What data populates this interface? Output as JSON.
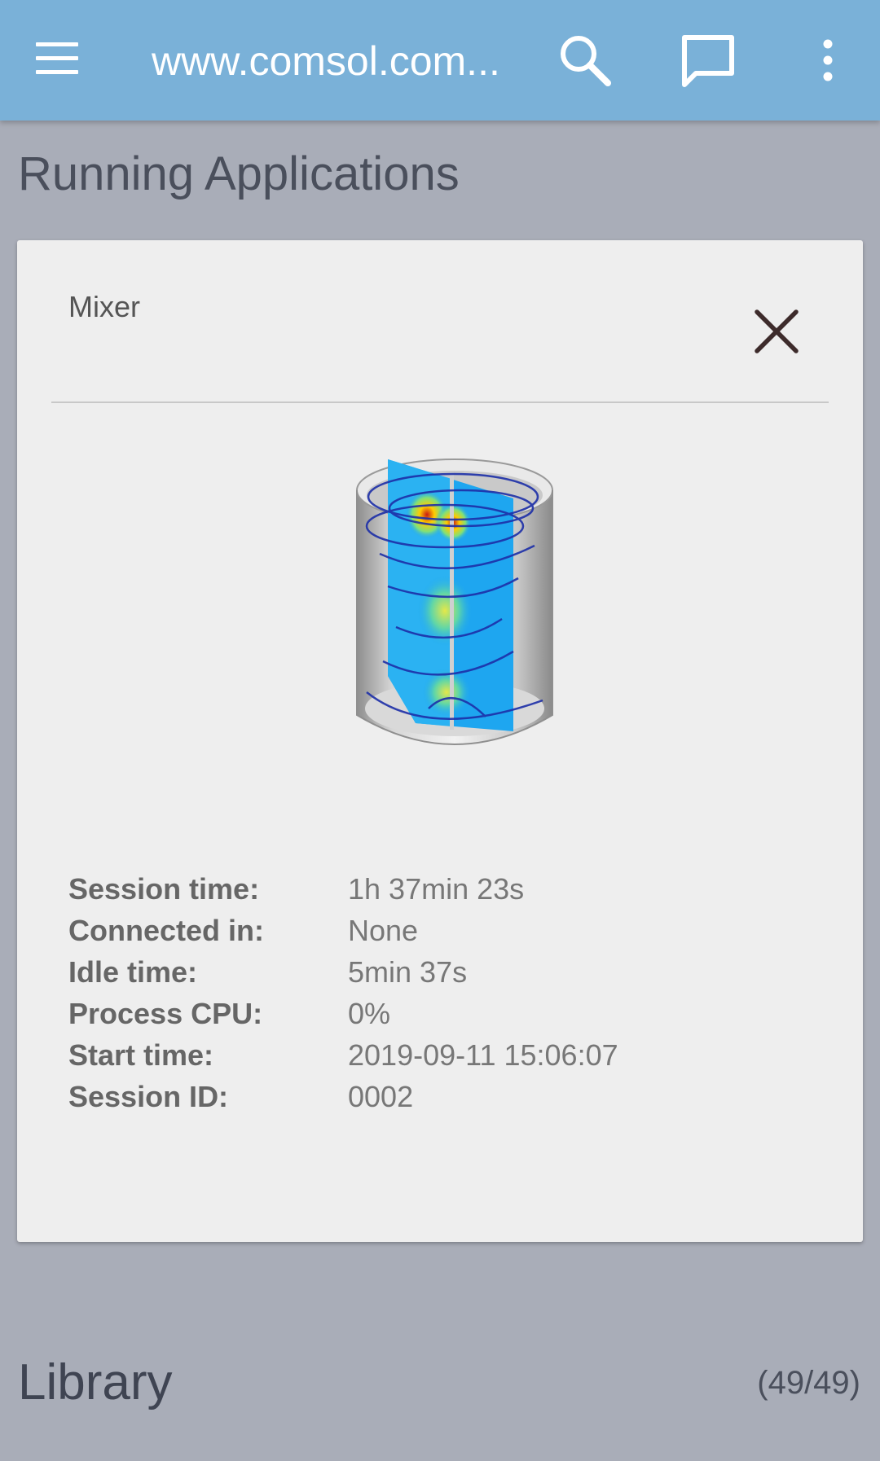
{
  "appbar": {
    "title": "www.comsol.com...",
    "menu_icon": "hamburger-menu-icon",
    "search_icon": "search-icon",
    "chat_icon": "chat-bubble-icon",
    "more_icon": "more-vert-icon",
    "color": "#7ab1d8"
  },
  "running": {
    "title": "Running Applications",
    "card": {
      "app_name": "Mixer",
      "close_icon": "close-icon",
      "details": [
        {
          "label": "Session time:",
          "value": "1h 37min 23s"
        },
        {
          "label": "Connected in:",
          "value": "None"
        },
        {
          "label": "Idle time:",
          "value": "5min 37s"
        },
        {
          "label": "Process CPU:",
          "value": "0%"
        },
        {
          "label": "Start time:",
          "value": "2019-09-11 15:06:07"
        },
        {
          "label": "Session ID:",
          "value": "0002"
        }
      ]
    }
  },
  "library": {
    "title": "Library",
    "count": "(49/49)"
  }
}
